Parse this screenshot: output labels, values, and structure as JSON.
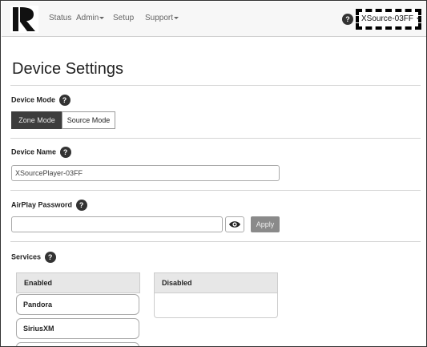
{
  "navbar": {
    "items": [
      {
        "label": "Status",
        "has_caret": false
      },
      {
        "label": "Admin",
        "has_caret": true
      },
      {
        "label": "Setup",
        "has_caret": false
      },
      {
        "label": "Support",
        "has_caret": true
      }
    ],
    "help_glyph": "?",
    "device_selector": "XSource-03FF"
  },
  "page": {
    "title": "Device Settings"
  },
  "device_mode": {
    "label": "Device Mode",
    "options": [
      "Zone Mode",
      "Source Mode"
    ],
    "selected": "Zone Mode"
  },
  "device_name": {
    "label": "Device Name",
    "value": "XSourcePlayer-03FF"
  },
  "airplay": {
    "label": "AirPlay Password",
    "value": "",
    "apply_label": "Apply"
  },
  "services": {
    "label": "Services",
    "enabled_header": "Enabled",
    "disabled_header": "Disabled",
    "enabled": [
      "Pandora",
      "SiriusXM"
    ],
    "disabled": []
  },
  "help_glyph": "?"
}
